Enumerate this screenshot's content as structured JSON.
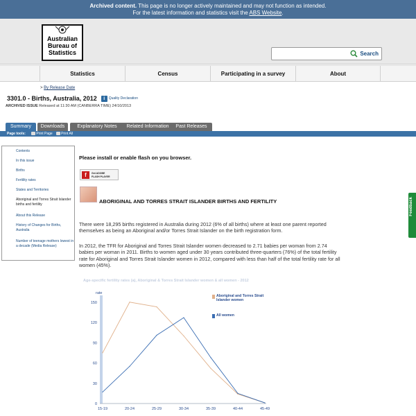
{
  "archive_notice": {
    "bold": "Archived content.",
    "line1_rest": " This page is no longer actively maintained and may not function as intended.",
    "line2_prefix": "For the latest information and statistics visit the ",
    "line2_link": "ABS Website",
    "line2_suffix": "."
  },
  "logo": {
    "line1": "Australian",
    "line2": "Bureau of",
    "line3": "Statistics"
  },
  "search": {
    "placeholder": "",
    "button_label": "Search"
  },
  "nav": [
    "Statistics",
    "Census",
    "Participating in a survey",
    "About"
  ],
  "breadcrumb": {
    "prefix": "> ",
    "link": "By Release Date"
  },
  "page": {
    "title": "3301.0 - Births, Australia, 2012",
    "quality_link": "Quality Declaration",
    "archived_label": "ARCHIVED ISSUE",
    "archived_text": " Released at 11:30 AM (CANBERRA TIME) 24/10/2013"
  },
  "tabs": [
    "Summary",
    "Downloads",
    "Explanatory Notes",
    "Related Information",
    "Past Releases"
  ],
  "page_tools": {
    "label": "Page tools:",
    "print_page": "Print Page",
    "print_all": "Print All"
  },
  "sidebar": [
    "Contents",
    "In this issue",
    "Births",
    "Fertility rates",
    "States and Territories",
    "Aboriginal and Torres Strait Islander births and fertility",
    "About this Release",
    "History of Changes for Births, Australia",
    "Number of teenage mothers lowest in a decade (Media Release)"
  ],
  "main": {
    "flash_message": "Please install or enable flash on you browser.",
    "flash_button_line1": "Get ADOBE",
    "flash_button_line2": "FLASH PLAYER",
    "section_title": "ABORIGINAL AND TORRES STRAIT ISLANDER BIRTHS AND FERTILITY",
    "para1": "There were 18,295 births registered in Australia during 2012 (6% of all births) where at least one parent reported themselves as being an Aboriginal and/or Torres Strait Islander on the birth registration form.",
    "para2": "In 2012, the TFR for Aboriginal and Torres Strait Islander women decreased to 2.71 babies per woman from 2.74 babies per woman in 2011. Births to women aged under 30 years contributed three-quarters (76%) of the total fertility rate for Aboriginal and Torres Strait Islander women in 2012, compared with less than half of the total fertility rate for all women (45%)."
  },
  "feedback_label": "Feedback",
  "colors": {
    "archive_bar": "#4a6f97",
    "tab_active": "#3c72a6",
    "series_indig": "#e0b08a",
    "series_all": "#3b6eb3"
  },
  "chart_data": {
    "type": "line",
    "title": "Age-specific fertility rates (a), Aboriginal & Torres Strait Islander women & all women - 2012",
    "ylabel": "rate",
    "categories": [
      "15-19",
      "20-24",
      "25-29",
      "30-34",
      "35-39",
      "40-44",
      "45-49"
    ],
    "yticks": [
      0,
      30,
      60,
      90,
      120,
      150
    ],
    "ylim": [
      0,
      160
    ],
    "series": [
      {
        "name": "Aboriginal and Torres Strait Islander women",
        "color": "#e0b08a",
        "values": [
          75,
          150,
          143,
          100,
          52,
          14,
          1
        ]
      },
      {
        "name": "All women",
        "color": "#3b6eb3",
        "values": [
          17,
          55,
          101,
          127,
          68,
          15,
          1
        ]
      }
    ],
    "grid": false,
    "legend": "top-right"
  }
}
